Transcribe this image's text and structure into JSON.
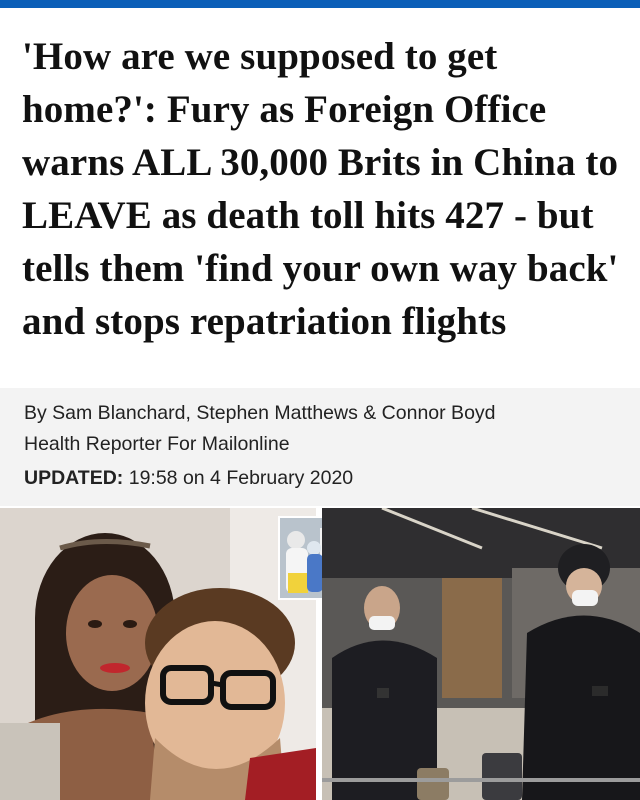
{
  "article": {
    "headline": "'How are we supposed to get home?': Fury as Foreign Office warns ALL 30,000 Brits in China to LEAVE as death toll hits 427 - but tells them 'find your own way back' and stops repatriation flights",
    "byline_authors": "By Sam Blanchard, Stephen Matthews & Connor Boyd",
    "byline_role": "Health Reporter For Mailonline",
    "updated_label": "UPDATED:",
    "updated_value": "19:58 on 4 February 2020"
  },
  "colors": {
    "top_bar": "#0b5fb8",
    "meta_background": "#f3f3f3"
  },
  "images": {
    "left": "couple-selfie-photo",
    "right": "airport-travellers-masks-photo",
    "inset": "medical-workers-protective-suits-photo"
  }
}
